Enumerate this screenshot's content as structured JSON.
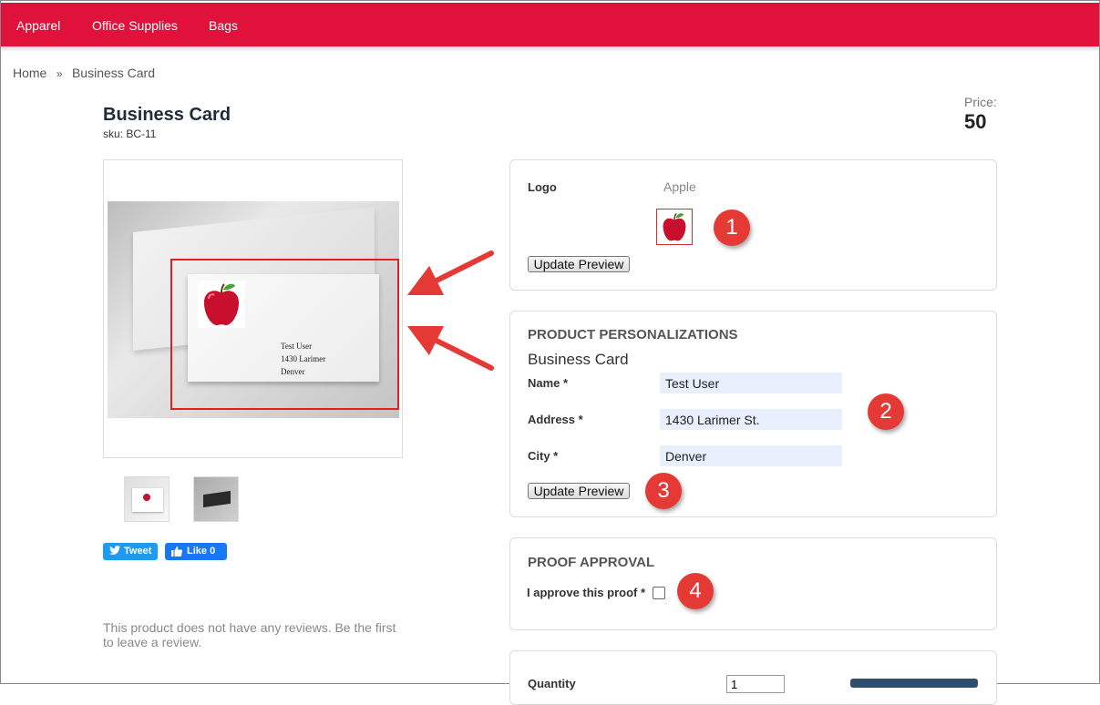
{
  "nav": {
    "items": [
      "Apparel",
      "Office Supplies",
      "Bags"
    ]
  },
  "breadcrumb": {
    "home": "Home",
    "separator": "»",
    "current": "Business Card"
  },
  "product": {
    "title": "Business Card",
    "sku": "sku: BC-11",
    "price_label": "Price:",
    "price": "50"
  },
  "preview_card": {
    "lines": [
      "Test User",
      "1430 Larimer",
      "Denver"
    ]
  },
  "social": {
    "tweet": "Tweet",
    "like": "Like 0"
  },
  "reviews_text": "This product does not have any reviews. Be the first to leave a review.",
  "logo_panel": {
    "label": "Logo",
    "selected": "Apple",
    "update_button": "Update Preview"
  },
  "personalization": {
    "heading": "PRODUCT PERSONALIZATIONS",
    "subheading": "Business Card",
    "fields": [
      {
        "label": "Name *",
        "value": "Test User"
      },
      {
        "label": "Address *",
        "value": "1430 Larimer St."
      },
      {
        "label": "City *",
        "value": "Denver"
      }
    ],
    "update_button": "Update Preview"
  },
  "proof": {
    "heading": "PROOF APPROVAL",
    "label": "I approve this proof *",
    "checked": false
  },
  "quantity": {
    "label": "Quantity",
    "value": "1"
  },
  "callouts": [
    "1",
    "2",
    "3",
    "4"
  ],
  "colors": {
    "nav": "#e0113a",
    "callout": "#e53935",
    "field_bg": "#e8f0fe",
    "highlight": "#e02020"
  }
}
